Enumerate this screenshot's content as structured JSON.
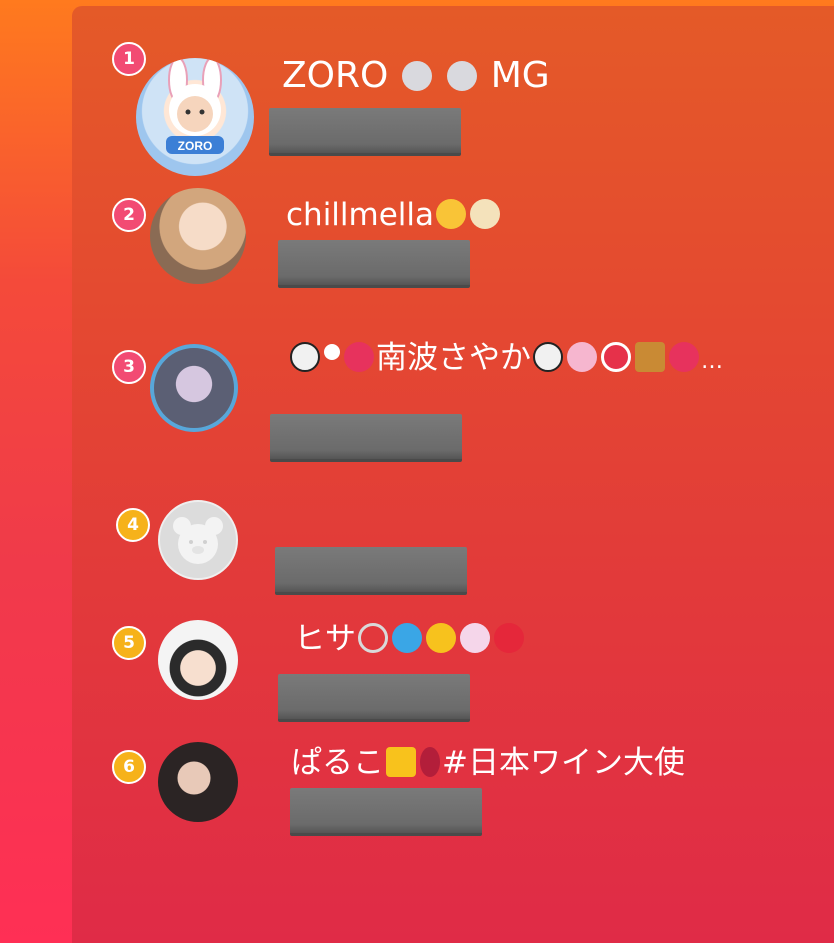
{
  "ranking": {
    "items": [
      {
        "rank": "1",
        "name_prefix": "ZORO",
        "name_suffix": "MG",
        "icons": [
          "rabbit-icon",
          "rabbit-icon"
        ],
        "avatar": "user-avatar"
      },
      {
        "rank": "2",
        "name_prefix": "chillmella",
        "name_suffix": "",
        "icons": [
          "chick-icon",
          "dumpling-icon"
        ],
        "avatar": "user-avatar"
      },
      {
        "rank": "3",
        "name_prefix": "",
        "name_middle": "南波さやか",
        "name_suffix": "…",
        "icons": [
          "panda-icon",
          "ribbon-icon",
          "hibiscus-icon",
          "panda-icon",
          "cherry-blossom-icon",
          "no-entry-icon",
          "whisky-icon",
          "hibiscus-icon"
        ],
        "avatar": "user-avatar"
      },
      {
        "rank": "4",
        "name_prefix": "",
        "name_suffix": "",
        "icons": [],
        "avatar": "default-bear-avatar"
      },
      {
        "rank": "5",
        "name_prefix": "ヒサ",
        "name_suffix": "",
        "icons": [
          "ring-icon",
          "dolphin-icon",
          "sunflower-icon",
          "unicorn-icon",
          "strawberry-icon"
        ],
        "avatar": "user-avatar"
      },
      {
        "rank": "6",
        "name_prefix": "ぱるこ",
        "name_suffix": "#日本ワイン大使",
        "icons": [
          "star-icon",
          "wine-glass-icon"
        ],
        "avatar": "user-avatar"
      }
    ]
  },
  "colors": {
    "rank_top": "#f24b73",
    "rank_other": "#f6b21a",
    "mask": "#6b6b6b"
  }
}
